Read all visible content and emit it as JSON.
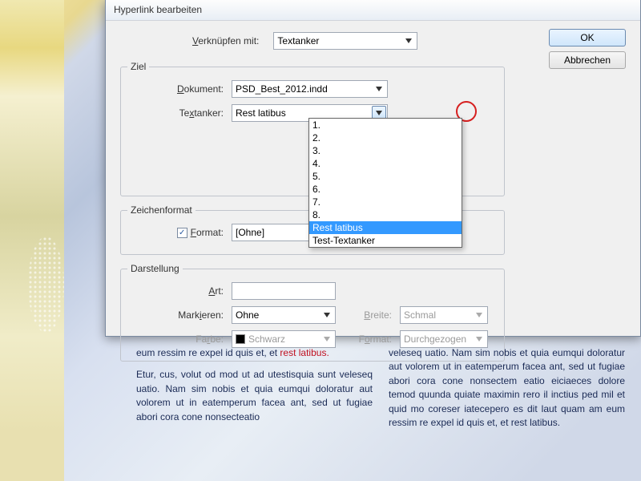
{
  "dialog": {
    "title": "Hyperlink bearbeiten",
    "link_with_label": "Verknüpfen mit:",
    "link_with_value": "Textanker",
    "buttons": {
      "ok": "OK",
      "cancel": "Abbrechen"
    },
    "ziel": {
      "legend": "Ziel",
      "dokument_label": "Dokument:",
      "dokument_value": "PSD_Best_2012.indd",
      "textanker_label": "Textanker:",
      "textanker_value": "Rest latibus",
      "options": [
        "1.",
        "2.",
        "3.",
        "4.",
        "5.",
        "6.",
        "7.",
        "8.",
        "Rest latibus",
        "Test-Textanker"
      ],
      "selected": "Rest latibus"
    },
    "zeichenformat": {
      "legend": "Zeichenformat",
      "format_label": "Format:",
      "format_value": "[Ohne]",
      "checked": true
    },
    "darstellung": {
      "legend": "Darstellung",
      "art_label": "Art:",
      "art_value": "",
      "markieren_label": "Markieren:",
      "markieren_value": "Ohne",
      "farbe_label": "Farbe:",
      "farbe_value": "Schwarz",
      "breite_label": "Breite:",
      "breite_value": "Schmal",
      "format_label": "Format:",
      "format_value": "Durchgezogen"
    }
  },
  "body_text": {
    "col1_line1": "eum ressim re expel id quis et, et ",
    "col1_red": "rest latibus.",
    "col1_para2": "Etur, cus, volut od mod ut ad utestisquia sunt veleseq uatio. Nam sim nobis et quia eumqui doloratur aut volorem ut in eatemperum facea ant, sed ut fugiae abori cora cone nonsecteatio",
    "col2": "veleseq uatio. Nam sim nobis et quia eumqui doloratur aut volorem ut in eatemperum facea ant, sed ut fugiae abori cora cone nonsectem eatio eiciaeces dolore temod quunda quiate maximin rero il inctius ped mil et quid mo coreser iatecepero es dit laut quam am eum ressim re expel id quis et, et rest latibus."
  }
}
